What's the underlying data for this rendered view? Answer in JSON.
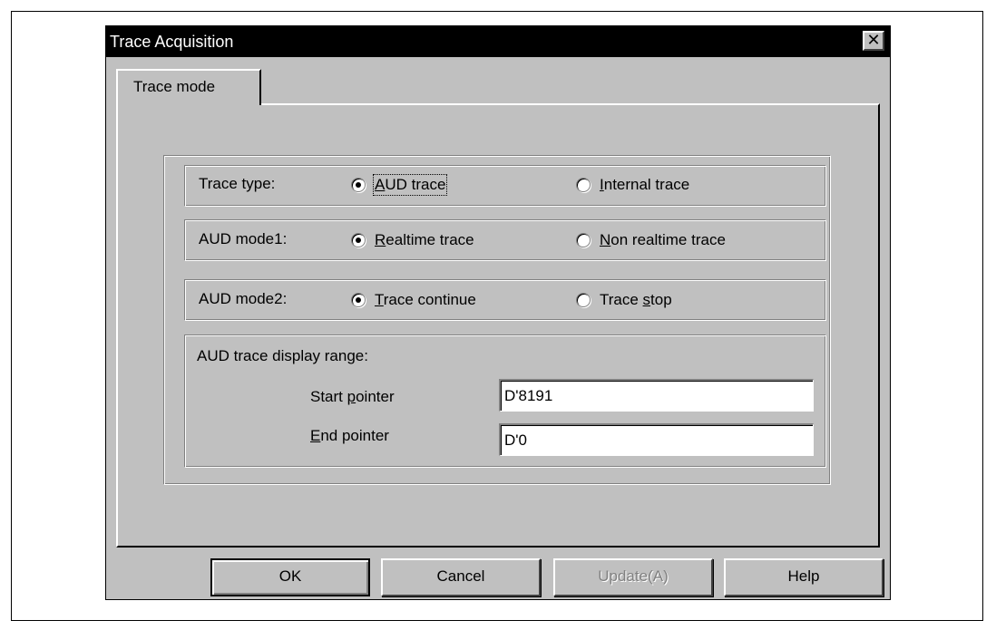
{
  "window": {
    "title": "Trace Acquisition",
    "close_glyph": "✕"
  },
  "tabs": [
    {
      "label": "Trace mode",
      "active": true
    }
  ],
  "trace_type": {
    "label": "Trace type:",
    "options": [
      {
        "label": "AUD trace",
        "mnemonic": "A",
        "checked": true
      },
      {
        "label": "Internal trace",
        "mnemonic": "I",
        "checked": false
      }
    ]
  },
  "aud_mode1": {
    "label": "AUD mode1:",
    "options": [
      {
        "label": "Realtime trace",
        "mnemonic": "R",
        "checked": true
      },
      {
        "label": "Non realtime trace",
        "mnemonic": "N",
        "checked": false
      }
    ]
  },
  "aud_mode2": {
    "label": "AUD mode2:",
    "options": [
      {
        "label": "Trace continue",
        "mnemonic": "T",
        "checked": true
      },
      {
        "label": "Trace stop",
        "mnemonic": "s",
        "checked": false
      }
    ]
  },
  "range": {
    "label": "AUD trace display range:",
    "start_label": "Start pointer",
    "start_value": "D'8191",
    "end_label": "End pointer",
    "end_value": "D'0"
  },
  "buttons": {
    "ok": "OK",
    "cancel": "Cancel",
    "update": "Update(A)",
    "help": "Help"
  },
  "icons": {
    "close": "close-icon",
    "radio_checked": "radio-checked-icon",
    "radio_unchecked": "radio-unchecked-icon"
  }
}
